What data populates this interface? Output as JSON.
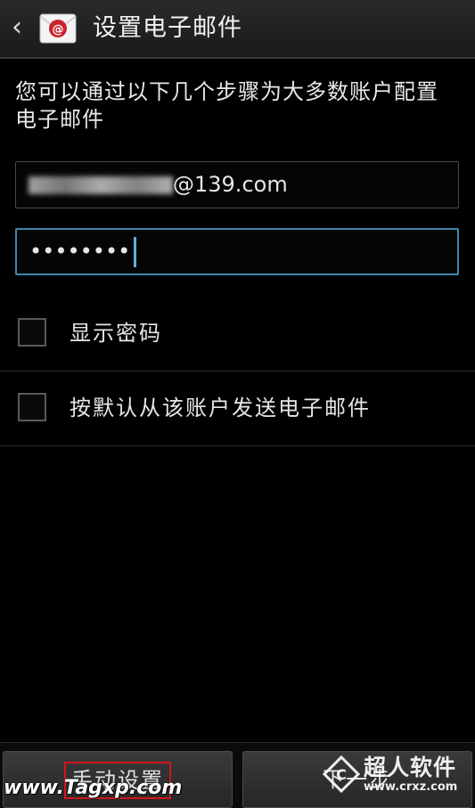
{
  "header": {
    "back_icon": "chevron-left-icon",
    "app_icon": "email-app-icon",
    "title": "设置电子邮件"
  },
  "intro_text": "您可以通过以下几个步骤为大多数账户配置电子邮件",
  "form": {
    "email_visible_suffix": "@139.com",
    "password_value": "••••••••"
  },
  "options": [
    {
      "label": "显示密码",
      "checked": false
    },
    {
      "label": "按默认从该账户发送电子邮件",
      "checked": false
    }
  ],
  "buttons": {
    "manual_setup": "手动设置",
    "next": "下一步"
  },
  "watermarks": {
    "left": "www.Tagxp.com",
    "right_name": "超人软件",
    "right_url": "www.crxz.com"
  },
  "colors": {
    "focus_border": "#3f86a8",
    "highlight_box": "#d4141b",
    "app_icon_red": "#c8232c"
  }
}
